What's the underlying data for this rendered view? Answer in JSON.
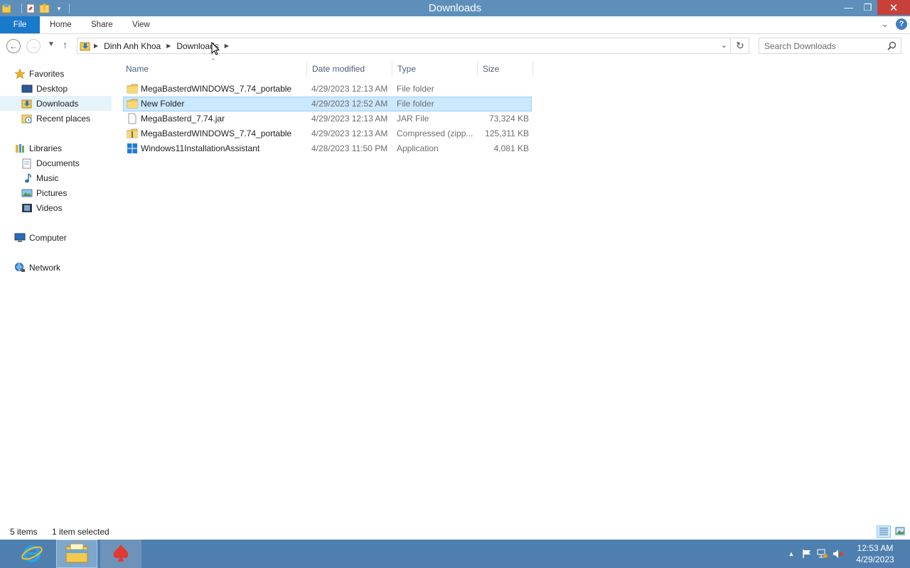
{
  "window": {
    "title": "Downloads"
  },
  "ribbon": {
    "tabs": [
      "File",
      "Home",
      "Share",
      "View"
    ]
  },
  "address": {
    "crumbs": [
      "Dinh Anh Khoa",
      "Downloads"
    ]
  },
  "search": {
    "placeholder": "Search Downloads"
  },
  "nav": {
    "favorites": "Favorites",
    "desktop": "Desktop",
    "downloads": "Downloads",
    "recent": "Recent places",
    "libraries": "Libraries",
    "documents": "Documents",
    "music": "Music",
    "pictures": "Pictures",
    "videos": "Videos",
    "computer": "Computer",
    "network": "Network"
  },
  "columns": {
    "name": "Name",
    "date": "Date modified",
    "type": "Type",
    "size": "Size"
  },
  "files": [
    {
      "name": "MegaBasterdWINDOWS_7.74_portable",
      "date": "4/29/2023 12:13 AM",
      "type": "File folder",
      "size": "",
      "icon": "folder-icon"
    },
    {
      "name": "New Folder",
      "date": "4/29/2023 12:52 AM",
      "type": "File folder",
      "size": "",
      "icon": "folder-icon"
    },
    {
      "name": "MegaBasterd_7.74.jar",
      "date": "4/29/2023 12:13 AM",
      "type": "JAR File",
      "size": "73,324 KB",
      "icon": "file-icon"
    },
    {
      "name": "MegaBasterdWINDOWS_7.74_portable",
      "date": "4/29/2023 12:13 AM",
      "type": "Compressed (zipp...",
      "size": "125,311 KB",
      "icon": "zip-folder-icon"
    },
    {
      "name": "Windows11InstallationAssistant",
      "date": "4/28/2023 11:50 PM",
      "type": "Application",
      "size": "4,081 KB",
      "icon": "windows-app-icon"
    }
  ],
  "status": {
    "items": "5 items",
    "selected": "1 item selected"
  },
  "clock": {
    "time": "12:53 AM",
    "date": "4/29/2023"
  },
  "colors": {
    "titlebar": "#5d8fba",
    "file_tab": "#1979ca",
    "selection": "#cce8ff",
    "taskbar": "#4f7fae"
  }
}
